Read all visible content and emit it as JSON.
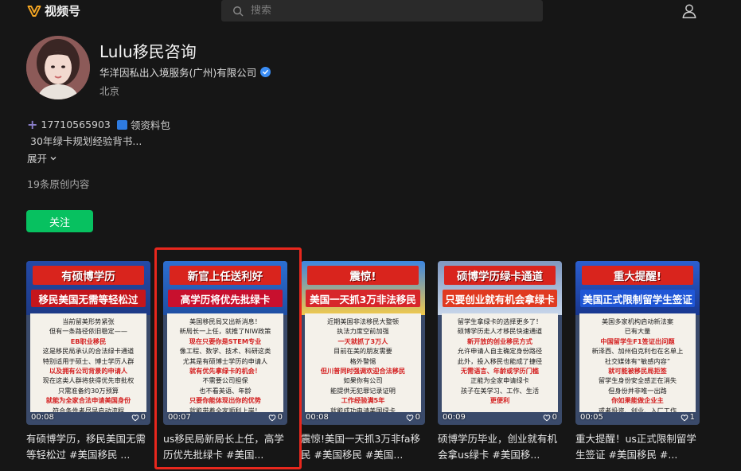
{
  "app": {
    "name": "视频号",
    "brand_color": "#f5a623"
  },
  "search": {
    "placeholder": "搜索"
  },
  "profile": {
    "name": "Lulu移民咨询",
    "company": "华洋因私出入境服务(广州)有限公司",
    "location": "北京",
    "contact": "17710565903",
    "contact_extra": "领资料包",
    "bio_line2": "30年绿卡规划经验背书...",
    "expand_label": "展开",
    "count_text": "19条原创内容",
    "follow_label": "关注"
  },
  "colors": {
    "accent_green": "#07c160",
    "highlight": "#e8271d",
    "verified": "#3a8df5"
  },
  "videos": [
    {
      "title": "有硕博学历",
      "subtitle": "移民美国无需等轻松过",
      "body": [
        "当前留美形势紧张",
        "但有一条路径依旧稳定——",
        "EB职业移民",
        "这是移民局承认的合法绿卡通道",
        "特别适用于硕士、博士学历人群",
        "以及拥有公司背景的申请人",
        "现在这类人群将获得优先审批权",
        "只需准备约30万预算",
        "就能为全家合法申请美国身份",
        "符合条件者尽早启动流程"
      ],
      "duration": "00:08",
      "likes": "0",
      "caption": "有硕博学历，移民美国无需等轻松过 #美国移民 ..."
    },
    {
      "title": "新官上任送利好",
      "subtitle": "高学历将优先批绿卡",
      "body": [
        "美国移民局又出新消息！",
        "新局长一上任，就推了NIW政策",
        "现在只要你是STEM专业",
        "像工程、数学、技术、科研这类",
        "尤其是有硕博士学历的申请人",
        "就有优先拿绿卡的机会！",
        "不需要公司担保",
        "也不看英语、年龄",
        "只要你能体现出你的优势",
        "就能带着全家顺利上岸！"
      ],
      "duration": "00:07",
      "likes": "0",
      "caption": "us移民局新局长上任，高学历优先批绿卡 #美国..."
    },
    {
      "title": "震惊!",
      "subtitle": "美国一天抓3万非法移民",
      "body": [
        "近期美国非法移民大整顿",
        "执法力度空前加强",
        "一天就抓了3万人",
        "目前在美的朋友需要",
        "格外警惕",
        "但川普同时强调欢迎合法移民",
        "如果你有公司",
        "能提供无犯罪记录证明",
        "工作经验满5年",
        "就能成功申请美国绿卡"
      ],
      "duration": "00:08",
      "likes": "0",
      "caption": "震惊!美国一天抓3万非fa移民 #美国移民 #美国..."
    },
    {
      "title": "硕博学历绿卡通道",
      "subtitle": "只要创业就有机会拿绿卡",
      "body": [
        "留学生拿绿卡的选择更多了！",
        "硕博学历走人才移民快速通道",
        "新开放的创业移民方式",
        "允许申请人自主确定身份路径",
        "此外，投入移民也能成了捷径",
        "无需语言、年龄或学历门槛",
        "正能为全家申请绿卡",
        "孩子在美学习、工作、生活",
        "更便利"
      ],
      "duration": "00:09",
      "likes": "0",
      "caption": "硕博学历毕业，创业就有机会拿us绿卡 #美国移..."
    },
    {
      "title": "重大提醒!",
      "subtitle": "美国正式限制留学生签证",
      "body": [
        "美国多家机构启动新法案",
        "已有大量",
        "中国留学生F1签证出问题",
        "新泽西、加州伯克利也在名单上",
        "社交媒体有“敏感内容”",
        "就可能被移民局拒签",
        "留学生身份安全感正在消失",
        "但身份并非唯一出路",
        "你如果能做企业主",
        "或者投资、创业、入厂工作",
        "在美国申请合法身份"
      ],
      "duration": "00:05",
      "likes": "1",
      "caption": "重大提醒！us正式限制留学生签证 #美国移民 #..."
    }
  ]
}
